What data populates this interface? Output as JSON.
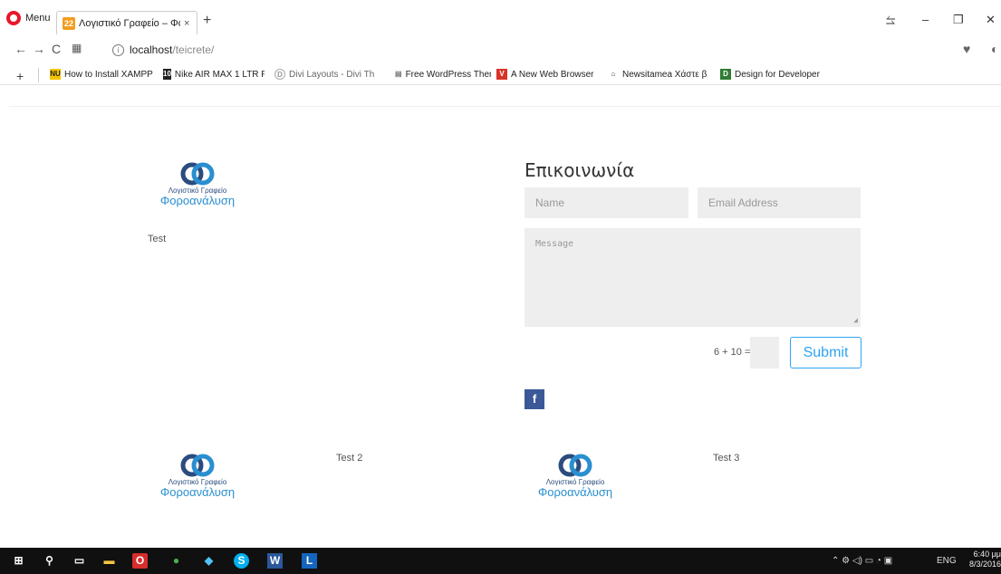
{
  "browser": {
    "menu_label": "Menu",
    "tab_title": "Λογιστικό Γραφείο – Φορο",
    "tab_favicon": "22",
    "url_host": "localhost",
    "url_path": "/teicrete/",
    "new_tab_glyph": "+",
    "close_glyph": "×"
  },
  "bookmarks": [
    {
      "label": "How to Install XAMPP",
      "icon": "NU",
      "color": "#f5c400"
    },
    {
      "label": "Nike AIR MAX 1 LTR F",
      "icon": "10",
      "color": "#222"
    },
    {
      "label": "Divi Layouts - Divi Th",
      "icon": "D",
      "color": "#bbb"
    },
    {
      "label": "Free WordPress Them",
      "icon": "▤",
      "color": "#888"
    },
    {
      "label": "A New Web Browser",
      "icon": "V",
      "color": "#d8332a"
    },
    {
      "label": "Newsitamea Χάστε β",
      "icon": "N",
      "color": "#555"
    },
    {
      "label": "Design for Developer",
      "icon": "D",
      "color": "#2e7d32"
    }
  ],
  "page": {
    "logo_line1": "Λογιστικό Γραφείο",
    "logo_line2": "Φοροανάλυση",
    "test1": "Test",
    "test2": "Test 2",
    "test3": "Test 3"
  },
  "contact": {
    "title": "Επικοινωνία",
    "name_placeholder": "Name",
    "email_placeholder": "Email Address",
    "message_placeholder": "Message",
    "captcha": "6 + 10 =",
    "submit_label": "Submit",
    "facebook_label": "f"
  },
  "taskbar": {
    "tray_text": "ENG",
    "time": "6:40 μμ",
    "date": "8/3/2016"
  },
  "colors": {
    "accent": "#2ea3f2",
    "facebook": "#3b5998",
    "logo_blue": "#2a8fd0"
  }
}
